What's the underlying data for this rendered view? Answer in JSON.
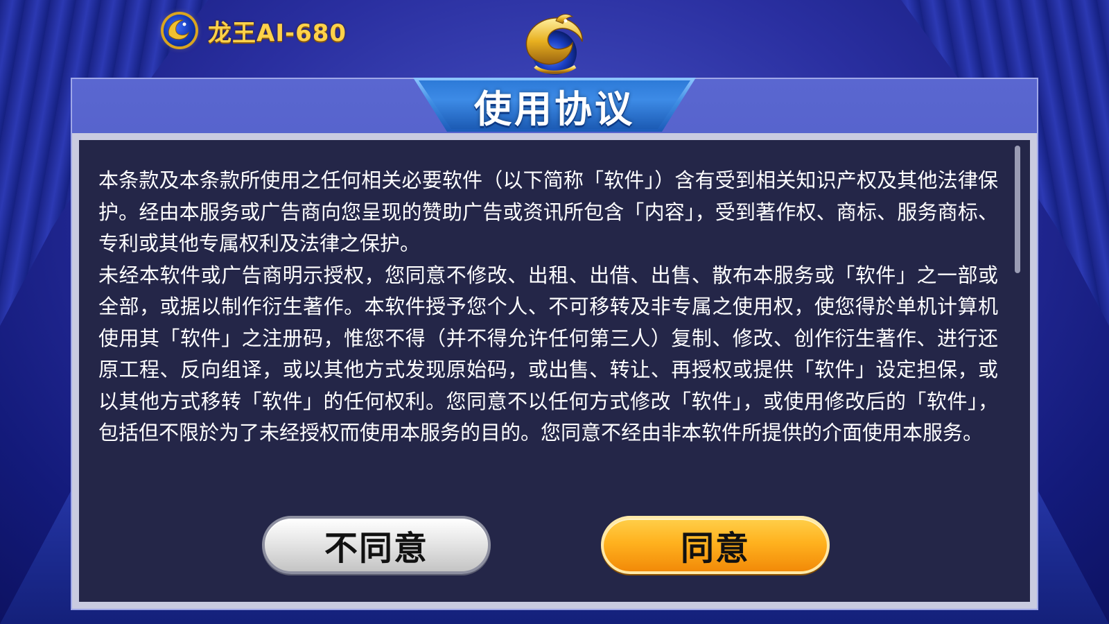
{
  "brand": {
    "name": "龙王AI-680",
    "icon": "dragon-ball-logo-icon"
  },
  "emblem": {
    "icon": "golden-dragon-emblem-icon"
  },
  "dialog": {
    "title": "使用协议",
    "paragraphs": [
      "本条款及本条款所使用之任何相关必要软件（以下简称「软件」）含有受到相关知识产权及其他法律保护。经由本服务或广告商向您呈现的赞助广告或资讯所包含「内容」，受到著作权、商标、服务商标、专利或其他专属权利及法律之保护。",
      "未经本软件或广告商明示授权，您同意不修改、出租、出借、出售、散布本服务或「软件」之一部或全部，或据以制作衍生著作。本软件授予您个人、不可移转及非专属之使用权，使您得於单机计算机使用其「软件」之注册码，惟您不得（并不得允许任何第三人）复制、修改、创作衍生著作、进行还原工程、反向组译，或以其他方式发现原始码，或出售、转让、再授权或提供「软件」设定担保，或以其他方式移转「软件」的任何权利。您同意不以任何方式修改「软件」，或使用修改后的「软件」，包括但不限於为了未经授权而使用本服务的目的。您同意不经由非本软件所提供的介面使用本服务。"
    ],
    "buttons": {
      "disagree": "不同意",
      "agree": "同意"
    }
  },
  "colors": {
    "agree_button": "#ffb21f",
    "disagree_button": "#e6e6e6",
    "content_background": "#242648",
    "title_tab": "#3d8be6",
    "brand_text": "#ffd24a"
  }
}
